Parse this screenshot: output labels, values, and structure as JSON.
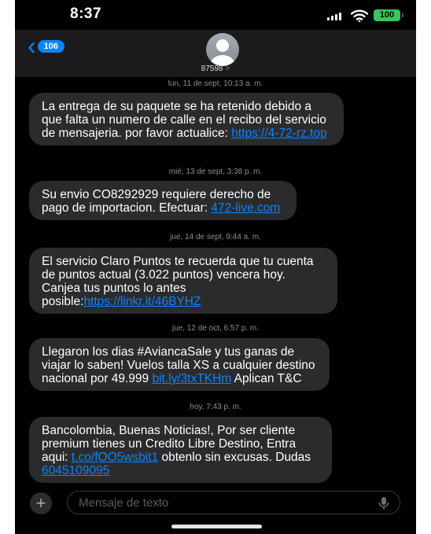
{
  "status_bar": {
    "time": "8:37",
    "battery": "100"
  },
  "header": {
    "back_count": "106",
    "contact": "87598",
    "contact_chevron": ">"
  },
  "messages": [
    {
      "timestamp": "lun, 11 de sept, 10:13 a. m.",
      "text": "La entrega de su paquete se ha retenido debido a que falta un numero de calle en el recibo del servicio de mensajeria. por favor actualice: ",
      "link": "https://4-72-rz.top",
      "after": ""
    },
    {
      "timestamp": "mié, 13 de sept, 3:38 p. m.",
      "text": "Su envio CO8292929 requiere derecho de pago de importacion. Efectuar: ",
      "link": "472-live.com",
      "after": ""
    },
    {
      "timestamp": "jue, 14 de sept, 9:44 a. m.",
      "text": "El servicio Claro Puntos te recuerda que tu cuenta de puntos actual (3.022 puntos) vencera hoy. Canjea tus puntos lo antes posible:",
      "link": "https://linkr.it/46BYHZ",
      "after": ""
    },
    {
      "timestamp": "jue, 12 de oct, 6:57 p. m.",
      "text": "Llegaron los dias #AviancaSale y tus ganas de viajar lo saben! Vuelos talla XS a cualquier destino nacional por 49.999 ",
      "link": "bit.ly/3txTKHm",
      "after": " Aplican T&C"
    },
    {
      "timestamp": "hoy, 7:43 p. m.",
      "text": "Bancolombia, Buenas Noticias!, Por ser cliente premium tienes un Credito Libre Destino, Entra aqui: ",
      "link": "t.co/fOO5wsbit1",
      "after": " obtenlo sin excusas. Dudas ",
      "link2": "6045109095"
    }
  ],
  "composer": {
    "placeholder": "Mensaje de texto"
  },
  "colors": {
    "accent": "#0a84ff",
    "bubble": "#2b2b2d",
    "battery": "#35c759"
  }
}
